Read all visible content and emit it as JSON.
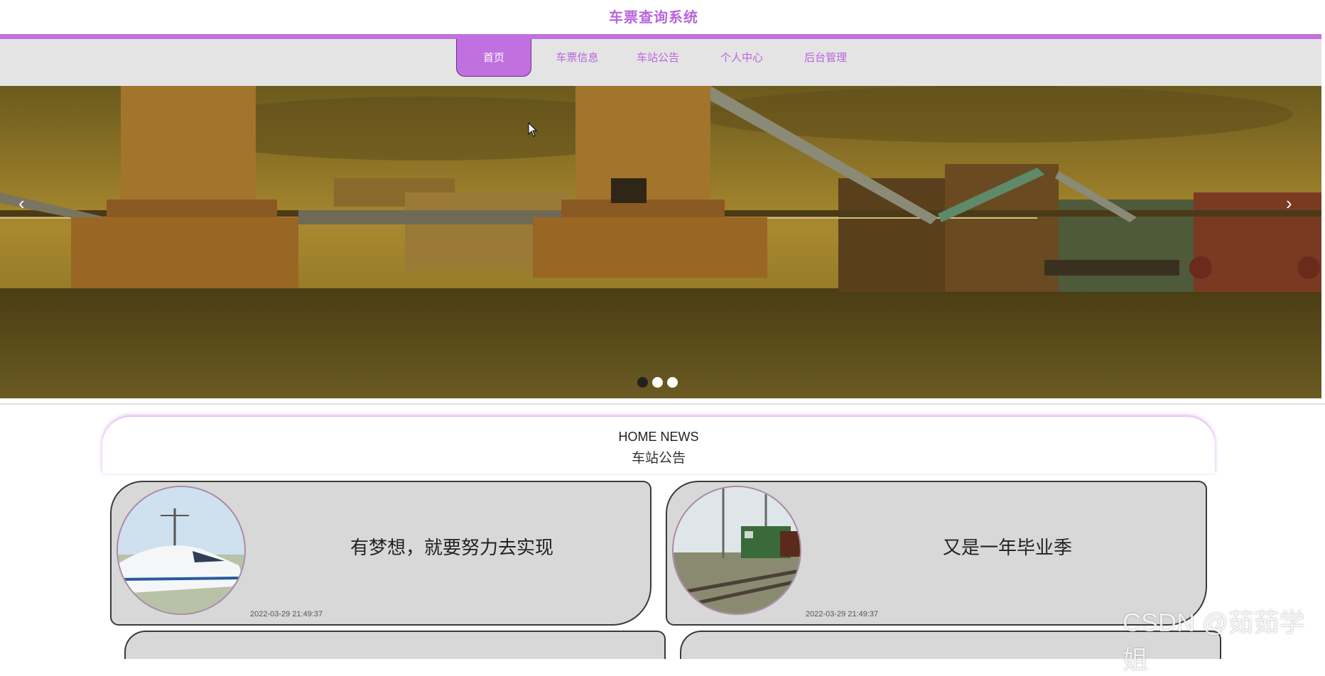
{
  "site": {
    "title": "车票查询系统"
  },
  "nav": {
    "items": [
      {
        "label": "首页",
        "active": true
      },
      {
        "label": "车票信息"
      },
      {
        "label": "车站公告"
      },
      {
        "label": "个人中心"
      },
      {
        "label": "后台管理"
      }
    ]
  },
  "carousel": {
    "prev_icon": "‹",
    "next_icon": "›",
    "slide_count": 3,
    "active_index": 0
  },
  "news": {
    "heading_en": "HOME NEWS",
    "heading_cn": "车站公告",
    "items": [
      {
        "title": "有梦想，就要努力去实现",
        "date": "2022-03-29 21:49:37"
      },
      {
        "title": "又是一年毕业季",
        "date": "2022-03-29 21:49:37"
      }
    ]
  },
  "watermark": "CSDN @茹茹学姐",
  "colors": {
    "accent": "#c170e0",
    "title": "#b866dc",
    "nav_bg": "#e4e4e4",
    "card_bg": "#d9d8d9"
  }
}
